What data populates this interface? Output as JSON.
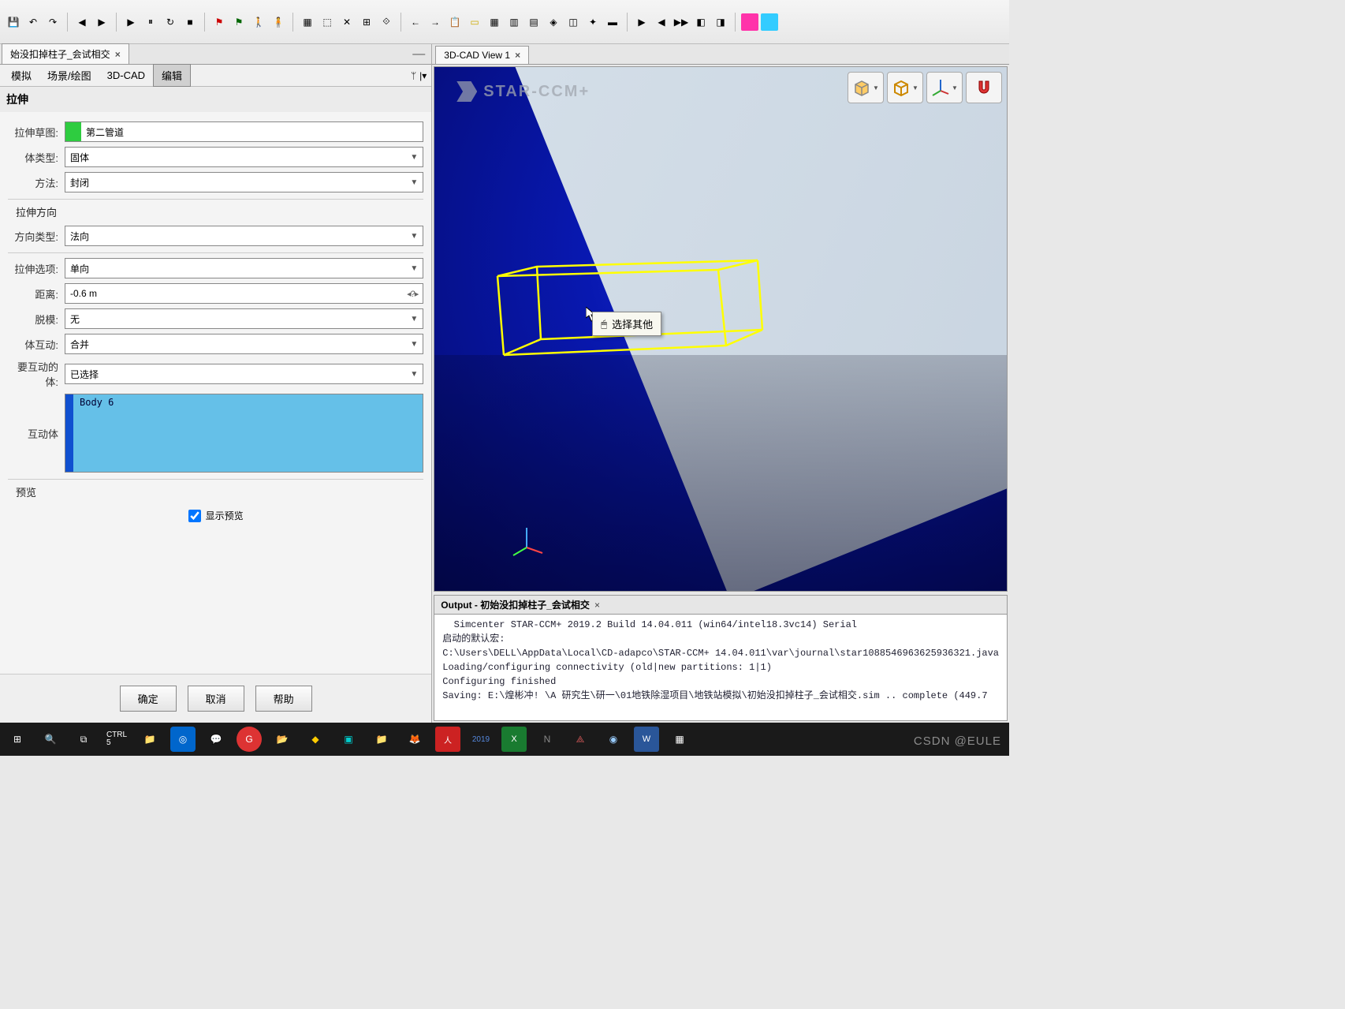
{
  "toolbar_icons_top": [
    "file",
    "save",
    "undo",
    "redo",
    "left",
    "right",
    "play",
    "spacer",
    "run",
    "stop",
    "flag",
    "flag2",
    "person",
    "stand"
  ],
  "toolbar_icons_mid": [
    "box",
    "region",
    "cross",
    "mesh",
    "link",
    "prev",
    "next",
    "copy",
    "yellow",
    "grid1",
    "grid2",
    "grid3",
    "cube-off",
    "slice",
    "triad",
    "swatch",
    "spacer",
    "tri1",
    "tri2",
    "tri3",
    "cube1",
    "cube2",
    "pink",
    "cyan"
  ],
  "left": {
    "doc_tab": "始没扣掉柱子_会试相交",
    "subtabs": {
      "sim": "模拟",
      "scene": "场景/绘图",
      "cad": "3D-CAD",
      "edit": "编辑"
    },
    "section_title": "拉伸",
    "fields": {
      "sketch_label": "拉伸草图:",
      "sketch_value": "第二管道",
      "body_type_label": "体类型:",
      "body_type_value": "固体",
      "method_label": "方法:",
      "method_value": "封闭",
      "direction_group": "拉伸方向",
      "dir_type_label": "方向类型:",
      "dir_type_value": "法向",
      "options_label": "拉伸选项:",
      "options_value": "单向",
      "distance_label": "距离:",
      "distance_value": "-0.6 m",
      "distance_suffix": "◂?▸",
      "draft_label": "脱模:",
      "draft_value": "无",
      "interaction_label": "体互动:",
      "interaction_value": "合并",
      "interact_body_label": "要互动的体:",
      "interact_body_value": "已选择",
      "list_label": "互动体",
      "list_item": "Body 6",
      "preview_group": "预览",
      "preview_checkbox": "显示预览"
    },
    "buttons": {
      "ok": "确定",
      "cancel": "取消",
      "help": "帮助"
    }
  },
  "view": {
    "tab_title": "3D-CAD View 1",
    "watermark": "STAR-CCM+",
    "context_menu": "选择其他"
  },
  "output": {
    "title": "Output - 初始没扣掉柱子_会试相交",
    "lines": [
      "  Simcenter STAR-CCM+ 2019.2 Build 14.04.011 (win64/intel18.3vc14) Serial",
      "启动的默认宏:",
      "C:\\Users\\DELL\\AppData\\Local\\CD-adapco\\STAR-CCM+ 14.04.011\\var\\journal\\star1088546963625936321.java",
      "Loading/configuring connectivity (old|new partitions: 1|1)",
      "Configuring finished",
      "Saving: E:\\煌彬冲! \\A 研究生\\研一\\01地铁除湿项目\\地铁站模拟\\初始没扣掉柱子_会试相交.sim .. complete (449.7"
    ]
  },
  "csdn_watermark": "CSDN @EULE"
}
